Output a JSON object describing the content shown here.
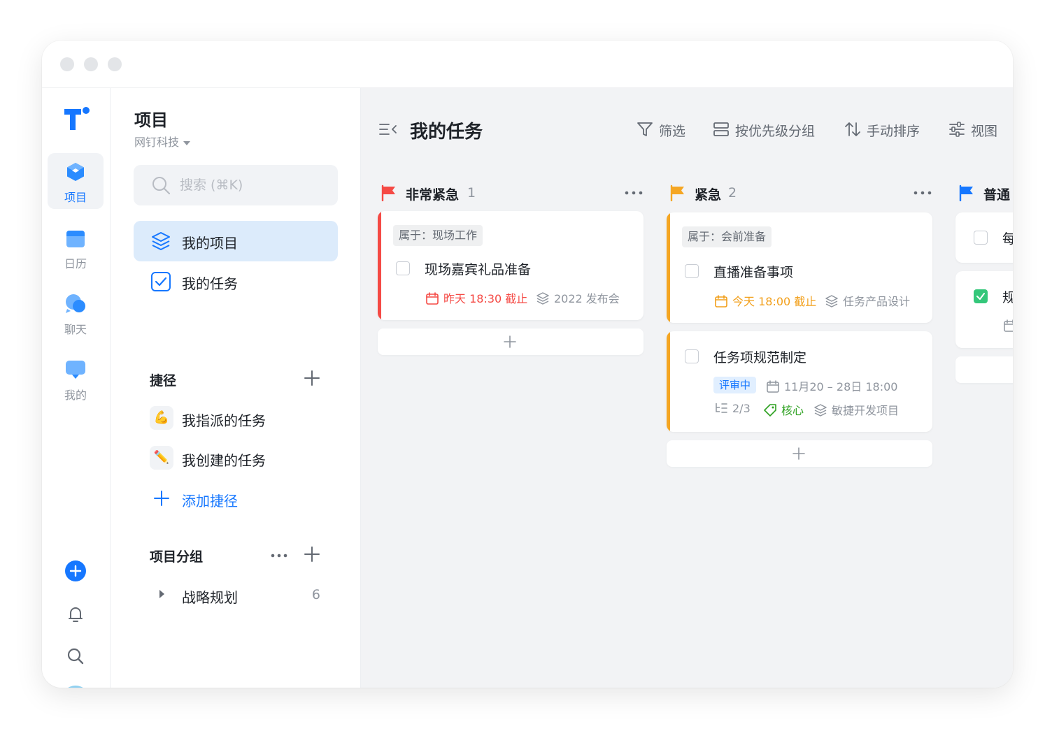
{
  "rail": {
    "items": [
      {
        "label": "项目"
      },
      {
        "label": "日历"
      },
      {
        "label": "聊天"
      },
      {
        "label": "我的"
      }
    ]
  },
  "side": {
    "title": "项目",
    "org": "网钉科技",
    "search_placeholder": "搜索 (⌘K)",
    "nav": [
      {
        "label": "我的项目"
      },
      {
        "label": "我的任务"
      }
    ],
    "shortcuts_title": "捷径",
    "shortcuts": [
      {
        "emoji": "💪",
        "label": "我指派的任务"
      },
      {
        "emoji": "✏️",
        "label": "我创建的任务"
      }
    ],
    "add_shortcut": "添加捷径",
    "groups_title": "项目分组",
    "groups": [
      {
        "label": "战略规划",
        "count": "6"
      }
    ]
  },
  "main": {
    "title": "我的任务",
    "toolbar": {
      "filter": "筛选",
      "group": "按优先级分组",
      "sort": "手动排序",
      "view": "视图"
    },
    "columns": [
      {
        "name": "非常紧急",
        "count": "1",
        "color": "#f54a45",
        "cards": [
          {
            "chip": "属于：现场工作",
            "title": "现场嘉宾礼品准备",
            "due": "昨天 18:30 截止",
            "project": "2022 发布会"
          }
        ]
      },
      {
        "name": "紧急",
        "count": "2",
        "color": "#f5a623",
        "cards": [
          {
            "chip": "属于：会前准备",
            "title": "直播准备事项",
            "due": "今天 18:00 截止",
            "project": "任务产品设计"
          },
          {
            "title": "任务项规范制定",
            "status": "评审中",
            "date_range": "11月20 – 28日 18:00",
            "subtasks": "2/3",
            "tag": "核心",
            "project": "敏捷开发项目"
          }
        ]
      },
      {
        "name": "普通",
        "color": "#1677ff",
        "cards": [
          {
            "title": "每",
            "done": false
          },
          {
            "title": "规",
            "done": true
          }
        ]
      }
    ]
  }
}
